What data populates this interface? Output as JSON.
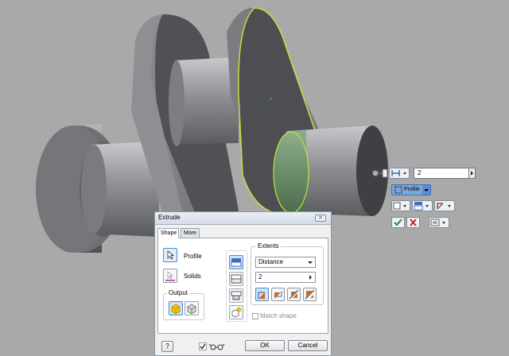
{
  "viewport": {
    "distance_value": "2",
    "profile_label": "Profile"
  },
  "dialog": {
    "title": "Extrude",
    "close_glyph": "✕",
    "tabs": [
      "Shape",
      "More"
    ],
    "profile_label": "Profile",
    "solids_label": "Solids",
    "output_label": "Output",
    "extents_label": "Extents",
    "extents_type": "Distance",
    "distance_value": "2",
    "match_shape_label": "Match shape",
    "ok_label": "OK",
    "cancel_label": "Cancel",
    "help_glyph": "?",
    "preview_checked": true
  },
  "colors": {
    "part_face": "#55575c",
    "part_side": "#8a8b8f",
    "selected_edge": "#c8e03c",
    "selected_fill": "#6d8f6d",
    "accept": "#2a8a2a",
    "reject": "#c81e1e"
  }
}
